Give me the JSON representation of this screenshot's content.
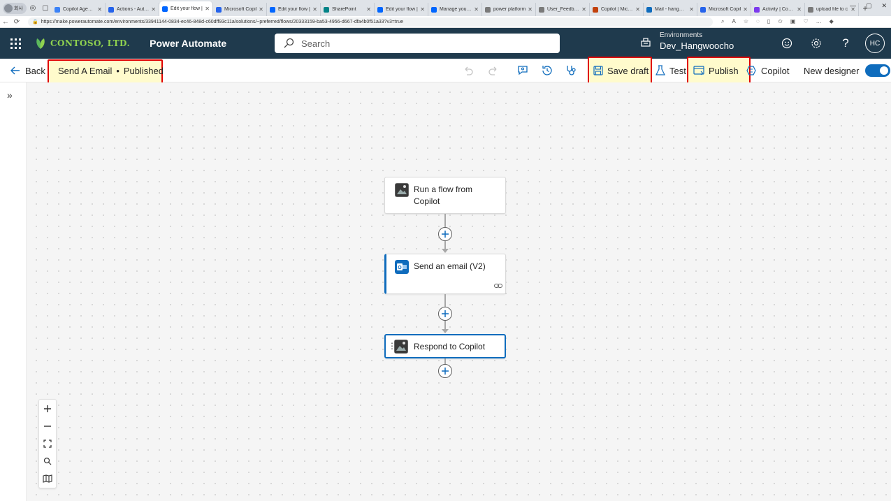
{
  "browser": {
    "profile_label": "회사",
    "tabs": [
      {
        "label": "Copilot Agent St",
        "color": "#3b82f6",
        "active": false
      },
      {
        "label": "Actions - Auto...",
        "color": "#2563eb",
        "active": false
      },
      {
        "label": "Edit your flow | ",
        "color": "#0066ff",
        "active": true
      },
      {
        "label": "Microsoft Copil",
        "color": "#2563eb",
        "active": false
      },
      {
        "label": "Edit your flow | ",
        "color": "#0066ff",
        "active": false
      },
      {
        "label": "SharePoint",
        "color": "#038387",
        "active": false
      },
      {
        "label": "Edit your flow | ",
        "color": "#0066ff",
        "active": false
      },
      {
        "label": "Manage your flo",
        "color": "#0066ff",
        "active": false
      },
      {
        "label": "power platform",
        "color": "#7a7a7a",
        "active": false
      },
      {
        "label": "User_Feedback",
        "color": "#7a7a7a",
        "active": false
      },
      {
        "label": "Copilot | Micros",
        "color": "#c2410c",
        "active": false
      },
      {
        "label": "Mail - hangwoo",
        "color": "#0f6cbd",
        "active": false
      },
      {
        "label": "Microsoft Copil",
        "color": "#2563eb",
        "active": false
      },
      {
        "label": "Activity | Conne",
        "color": "#7c3aed",
        "active": false
      },
      {
        "label": "upload file to c",
        "color": "#7a7a7a",
        "active": false
      }
    ],
    "url": "https://make.powerautomate.com/environments/33941144-0834-ec46-848d-c60dff93c11a/solutions/~preferred/flows/20333159-ba53-4956-d667-dfa4b0f51a33?v3=true"
  },
  "header": {
    "company": "CONTOSO, LTD.",
    "app_name": "Power Automate",
    "search_placeholder": "Search",
    "env_label": "Environments",
    "env_name": "Dev_Hangwoocho",
    "avatar_initials": "HC"
  },
  "command_bar": {
    "back_label": "Back",
    "flow_title": "Send A Email",
    "separator": "•",
    "flow_status": "Published",
    "save_draft_label": "Save draft",
    "test_label": "Test",
    "publish_label": "Publish",
    "copilot_label": "Copilot",
    "new_designer_label": "New designer",
    "new_designer_on": true
  },
  "flow": {
    "steps": [
      {
        "title_line1": "Run a flow from",
        "title_line2": "Copilot",
        "icon": "image-placeholder-icon"
      },
      {
        "title_line1": "Send an email (V2)",
        "title_line2": "",
        "icon": "outlook-icon"
      },
      {
        "title_line1": "Respond to Copilot",
        "title_line2": "",
        "icon": "image-placeholder-icon"
      }
    ]
  },
  "colors": {
    "header_bg": "#1f3a4d",
    "accent": "#0f6cbd",
    "highlight_border": "#e00000",
    "highlight_fill": "#fffbcc"
  }
}
